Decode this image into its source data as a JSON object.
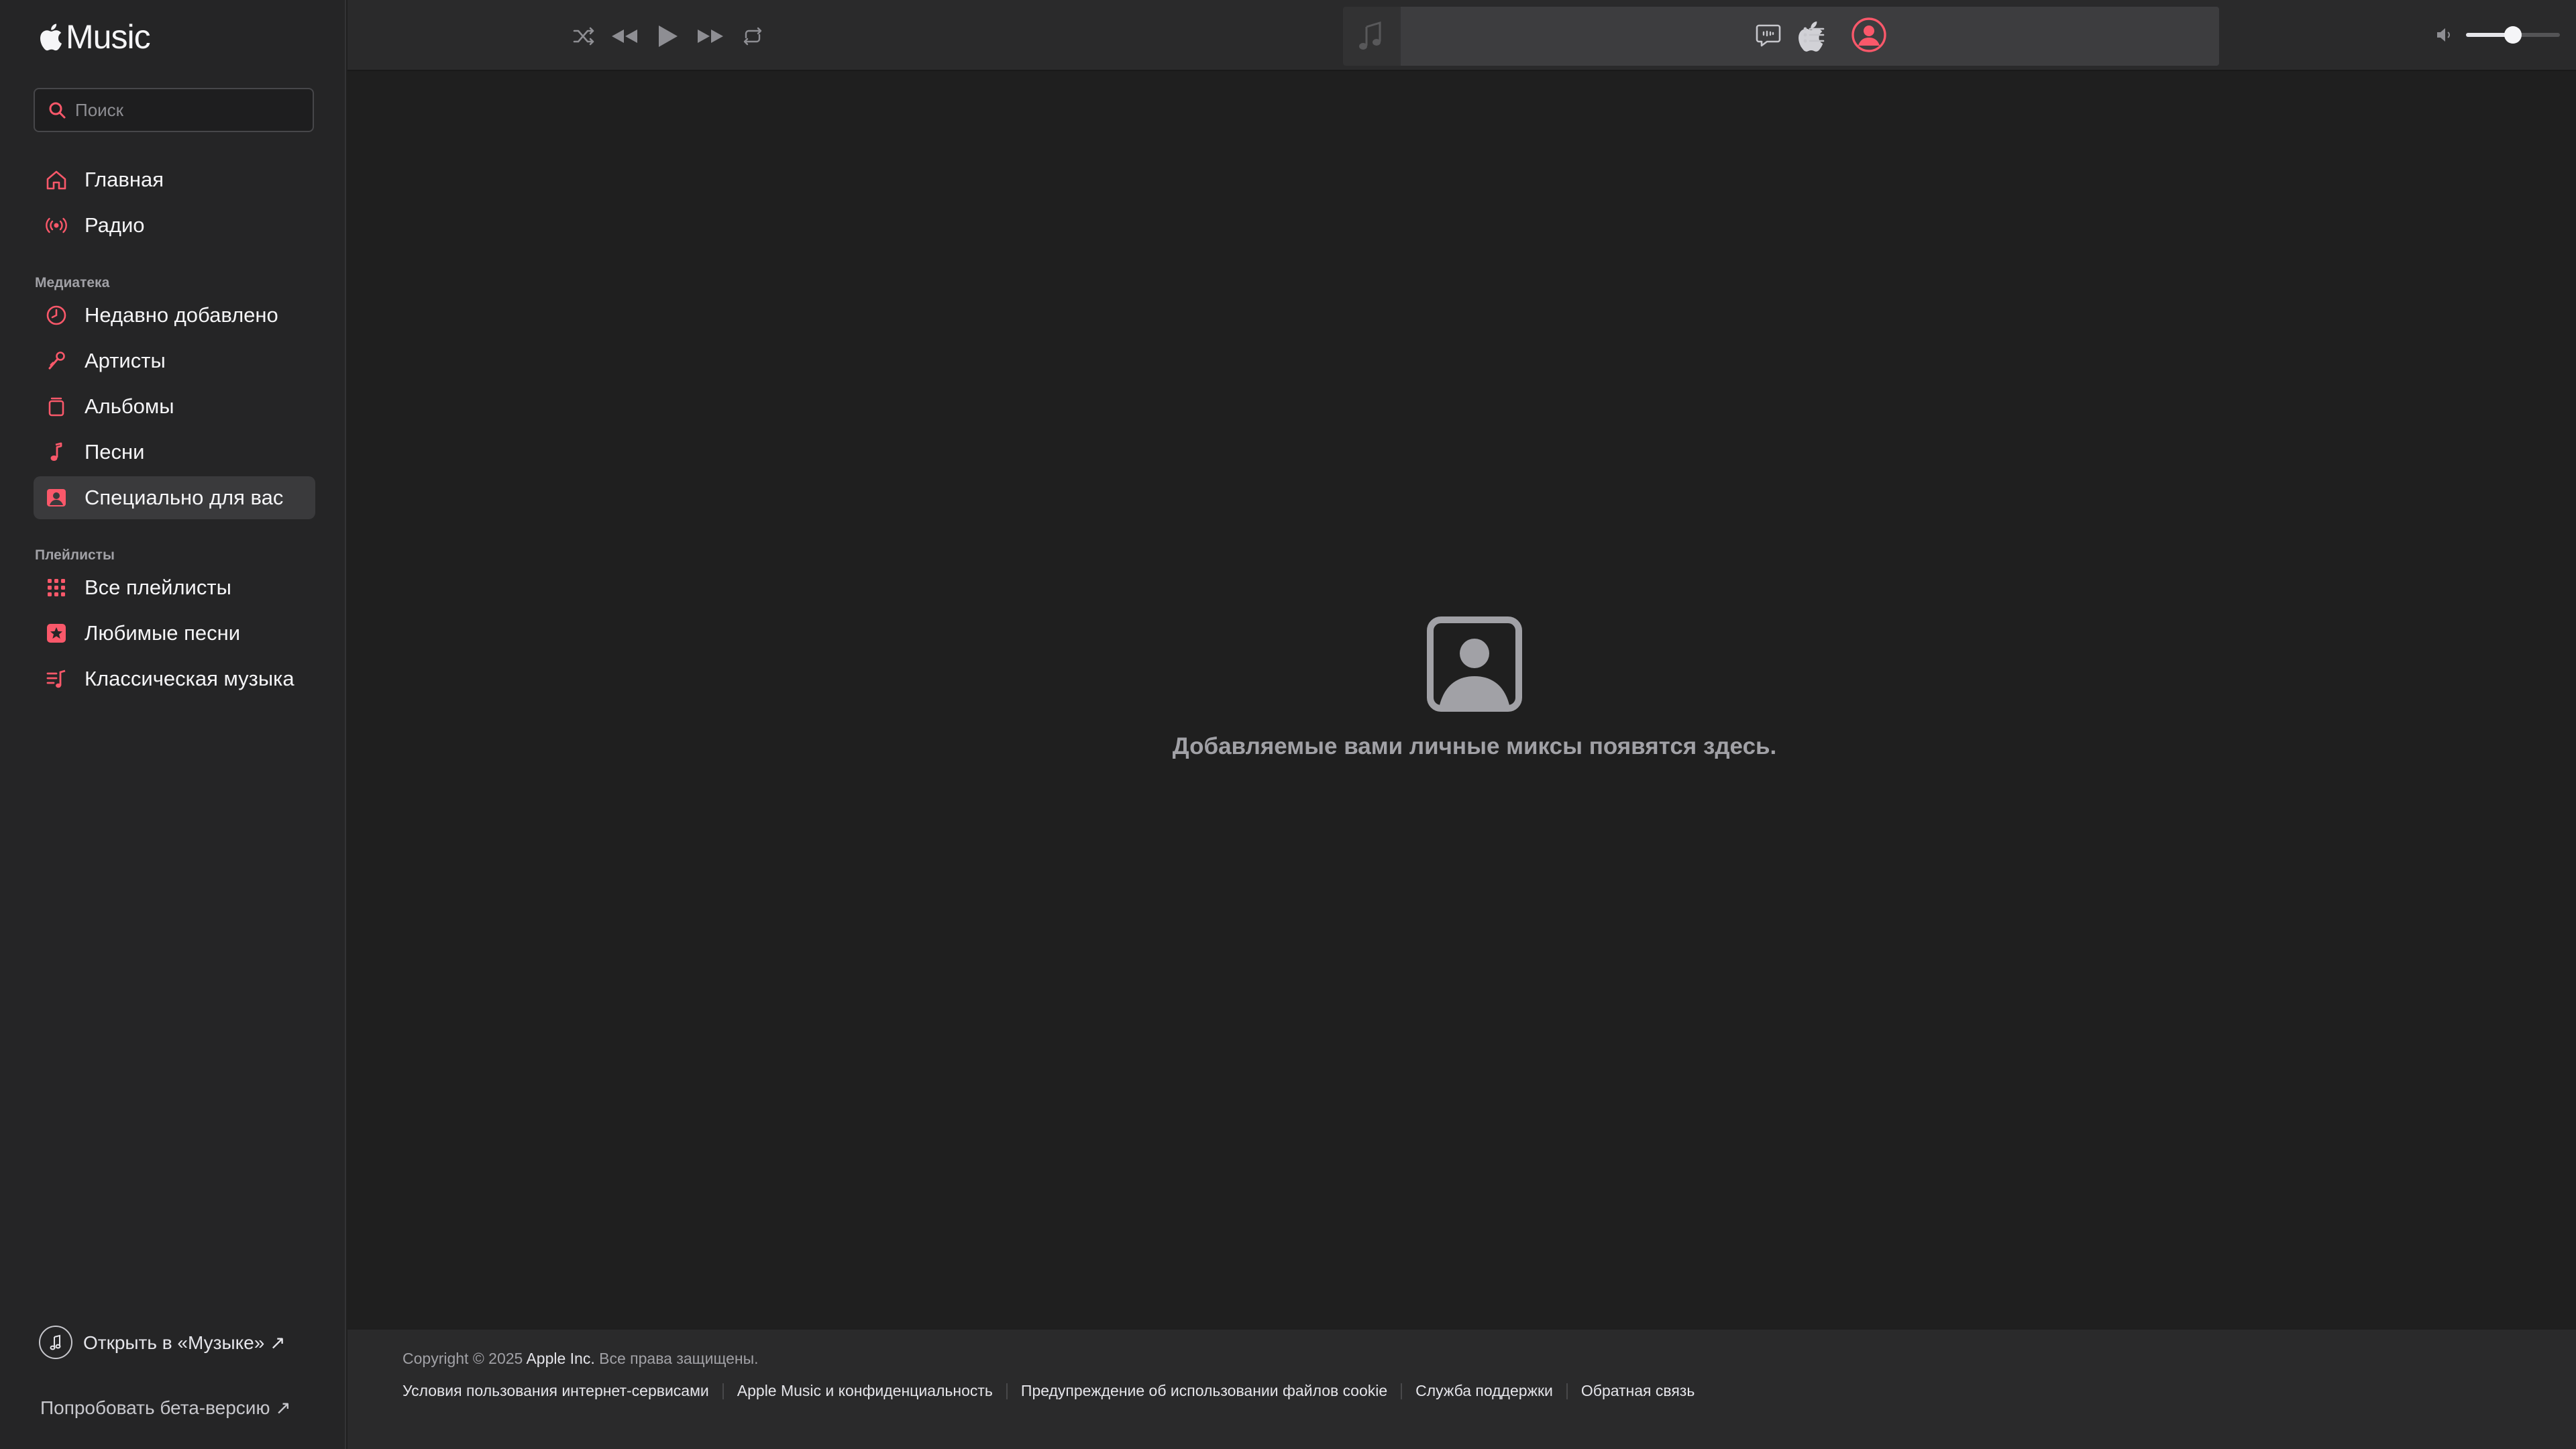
{
  "app": {
    "brand": "Music",
    "accent": "#fa586a"
  },
  "search": {
    "placeholder": "Поиск",
    "value": ""
  },
  "sidebar": {
    "top_items": [
      {
        "label": "Главная",
        "icon": "home-icon"
      },
      {
        "label": "Радио",
        "icon": "radio-icon"
      }
    ],
    "library_title": "Медиатека",
    "library_items": [
      {
        "label": "Недавно добавлено",
        "icon": "clock-icon"
      },
      {
        "label": "Артисты",
        "icon": "microphone-icon"
      },
      {
        "label": "Альбомы",
        "icon": "album-icon"
      },
      {
        "label": "Песни",
        "icon": "music-note-icon"
      },
      {
        "label": "Специально для вас",
        "icon": "person-square-icon",
        "active": true
      }
    ],
    "playlists_title": "Плейлисты",
    "playlist_items": [
      {
        "label": "Все плейлисты",
        "icon": "grid-icon"
      },
      {
        "label": "Любимые песни",
        "icon": "star-square-icon"
      },
      {
        "label": "Классическая музыка",
        "icon": "playlist-icon"
      }
    ],
    "open_in_music": "Открыть в «Музыке» ↗",
    "try_beta": "Попробовать бета-версию ↗"
  },
  "player": {
    "controls": [
      "shuffle-icon",
      "previous-icon",
      "play-icon",
      "next-icon",
      "repeat-icon"
    ],
    "volume": 0.5
  },
  "main": {
    "empty_message": "Добавляемые вами личные миксы появятся здесь."
  },
  "footer": {
    "copyright_prefix": "Copyright © 2025",
    "company": "Apple Inc.",
    "rights": "Все права защищены.",
    "links": [
      "Условия пользования интернет-сервисами",
      "Apple Music и конфиденциальность",
      "Предупреждение об использовании файлов cookie",
      "Служба поддержки",
      "Обратная связь"
    ]
  }
}
